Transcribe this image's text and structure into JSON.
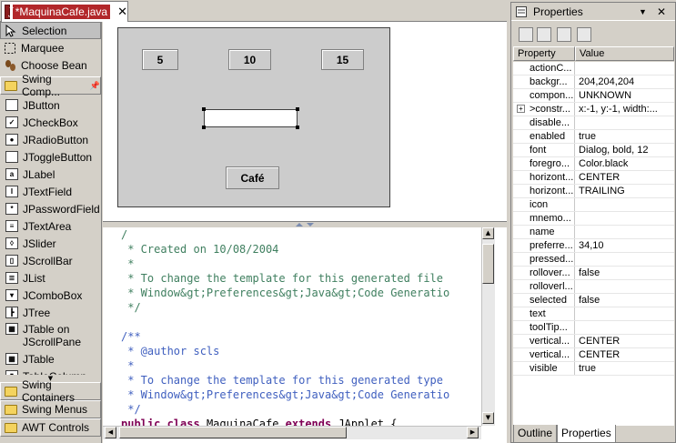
{
  "editor": {
    "tab_title": "*MaquinaCafe.java",
    "close_glyph": "✕"
  },
  "palette": {
    "tools": [
      {
        "label": "Selection",
        "icon": "arrow-cursor-icon"
      },
      {
        "label": "Marquee",
        "icon": "marquee-icon"
      },
      {
        "label": "Choose Bean",
        "icon": "bean-icon"
      }
    ],
    "drawer_open": "Swing Comp...",
    "pin_glyph": "📌",
    "items": [
      {
        "label": "JButton",
        "icon": "button-icon",
        "glyph": ""
      },
      {
        "label": "JCheckBox",
        "icon": "checkbox-icon",
        "glyph": "✓"
      },
      {
        "label": "JRadioButton",
        "icon": "radio-icon",
        "glyph": "●"
      },
      {
        "label": "JToggleButton",
        "icon": "toggle-icon",
        "glyph": ""
      },
      {
        "label": "JLabel",
        "icon": "label-icon",
        "glyph": "a"
      },
      {
        "label": "JTextField",
        "icon": "textfield-icon",
        "glyph": "I"
      },
      {
        "label": "JPasswordField",
        "icon": "password-icon",
        "glyph": "*"
      },
      {
        "label": "JTextArea",
        "icon": "textarea-icon",
        "glyph": "≡"
      },
      {
        "label": "JSlider",
        "icon": "slider-icon",
        "glyph": "◊"
      },
      {
        "label": "JScrollBar",
        "icon": "scrollbar-icon",
        "glyph": "▯"
      },
      {
        "label": "JList",
        "icon": "list-icon",
        "glyph": "≣"
      },
      {
        "label": "JComboBox",
        "icon": "combobox-icon",
        "glyph": "▾"
      },
      {
        "label": "JTree",
        "icon": "tree-icon",
        "glyph": "┣"
      },
      {
        "label": "JTable on JScrollPane",
        "icon": "table-scroll-icon",
        "glyph": "▦",
        "two_line": true
      },
      {
        "label": "JTable",
        "icon": "table-icon",
        "glyph": "▦"
      },
      {
        "label": "TableColumn",
        "icon": "table-column-icon",
        "glyph": "▮"
      }
    ],
    "drawers_closed": [
      "Swing Containers",
      "Swing Menus",
      "AWT Controls"
    ]
  },
  "design": {
    "buttons": [
      {
        "label": "5"
      },
      {
        "label": "10"
      },
      {
        "label": "15"
      },
      {
        "label": "Café"
      }
    ],
    "textfield_value": ""
  },
  "source": {
    "lines": [
      [
        {
          "t": "/",
          "c": "c"
        }
      ],
      [
        {
          "t": " * Created on 10/08/2004",
          "c": "c"
        }
      ],
      [
        {
          "t": " *",
          "c": "c"
        }
      ],
      [
        {
          "t": " * To change the template for this generated file",
          "c": "c"
        }
      ],
      [
        {
          "t": " * Window&gt;Preferences&gt;Java&gt;Code Generatio",
          "c": "c"
        }
      ],
      [
        {
          "t": " */",
          "c": "c"
        }
      ],
      [
        {
          "t": "",
          "c": ""
        }
      ],
      [
        {
          "t": "/**",
          "c": "d"
        }
      ],
      [
        {
          "t": " * @author scls",
          "c": "d"
        }
      ],
      [
        {
          "t": " *",
          "c": "d"
        }
      ],
      [
        {
          "t": " * To change the template for this generated type",
          "c": "d"
        }
      ],
      [
        {
          "t": " * Window&gt;Preferences&gt;Java&gt;Code Generatio",
          "c": "d"
        }
      ],
      [
        {
          "t": " */",
          "c": "d"
        }
      ],
      [
        {
          "t": "public",
          "c": "k"
        },
        {
          "t": " ",
          "c": ""
        },
        {
          "t": "class",
          "c": "k"
        },
        {
          "t": " MaquinaCafe ",
          "c": ""
        },
        {
          "t": "extends",
          "c": "k"
        },
        {
          "t": " JApplet {",
          "c": ""
        }
      ]
    ]
  },
  "properties": {
    "title": "Properties",
    "menu_glyph": "▼",
    "close_glyph": "✕",
    "col_property": "Property",
    "col_value": "Value",
    "rows": [
      {
        "name": "actionC...",
        "value": ""
      },
      {
        "name": "backgr...",
        "value": "204,204,204"
      },
      {
        "name": "compon...",
        "value": "UNKNOWN"
      },
      {
        "name": ">constr...",
        "value": "x:-1, y:-1, width:...",
        "expandable": true
      },
      {
        "name": "disable...",
        "value": ""
      },
      {
        "name": "enabled",
        "value": "true"
      },
      {
        "name": "font",
        "value": "Dialog, bold, 12"
      },
      {
        "name": "foregro...",
        "value": "Color.black"
      },
      {
        "name": "horizont...",
        "value": "CENTER"
      },
      {
        "name": "horizont...",
        "value": "TRAILING"
      },
      {
        "name": "icon",
        "value": ""
      },
      {
        "name": "mnemo...",
        "value": ""
      },
      {
        "name": "name",
        "value": ""
      },
      {
        "name": "preferre...",
        "value": "34,10"
      },
      {
        "name": "pressed...",
        "value": ""
      },
      {
        "name": "rollover...",
        "value": "false"
      },
      {
        "name": "rolloverl...",
        "value": ""
      },
      {
        "name": "selected",
        "value": "false"
      },
      {
        "name": "text",
        "value": ""
      },
      {
        "name": "toolTip...",
        "value": ""
      },
      {
        "name": "vertical...",
        "value": "CENTER"
      },
      {
        "name": "vertical...",
        "value": "CENTER"
      },
      {
        "name": "visible",
        "value": "true"
      }
    ],
    "tabs": [
      "Outline",
      "Properties"
    ],
    "active_tab": "Properties"
  }
}
